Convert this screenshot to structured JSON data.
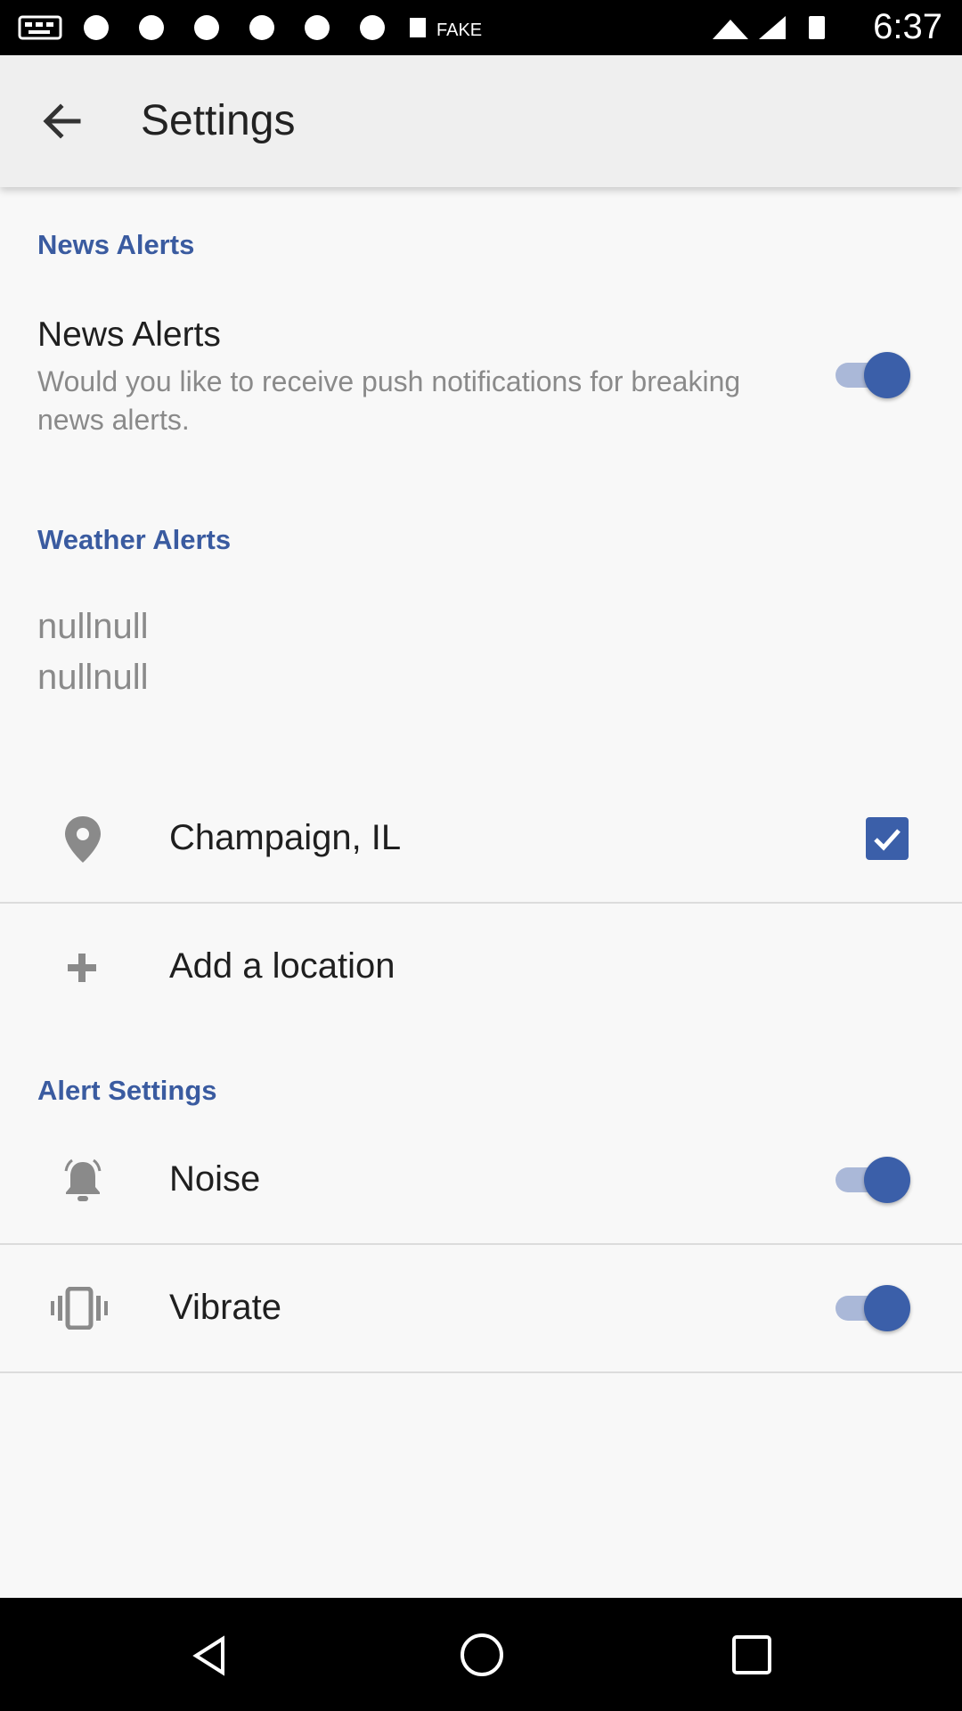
{
  "status_bar": {
    "time": "6:37"
  },
  "header": {
    "title": "Settings"
  },
  "news_section": {
    "heading": "News Alerts",
    "item": {
      "title": "News Alerts",
      "description": "Would you like to receive push notifications for breaking news alerts.",
      "enabled": true
    }
  },
  "weather_section": {
    "heading": "Weather Alerts",
    "lines": [
      "nullnull",
      "nullnull"
    ],
    "location": {
      "label": "Champaign, IL",
      "checked": true
    },
    "add_location": "Add a location"
  },
  "alert_section": {
    "heading": "Alert Settings",
    "noise": {
      "label": "Noise",
      "enabled": true
    },
    "vibrate": {
      "label": "Vibrate",
      "enabled": true
    }
  },
  "colors": {
    "accent": "#3b5fa9",
    "section_heading": "#3a5ba0"
  }
}
